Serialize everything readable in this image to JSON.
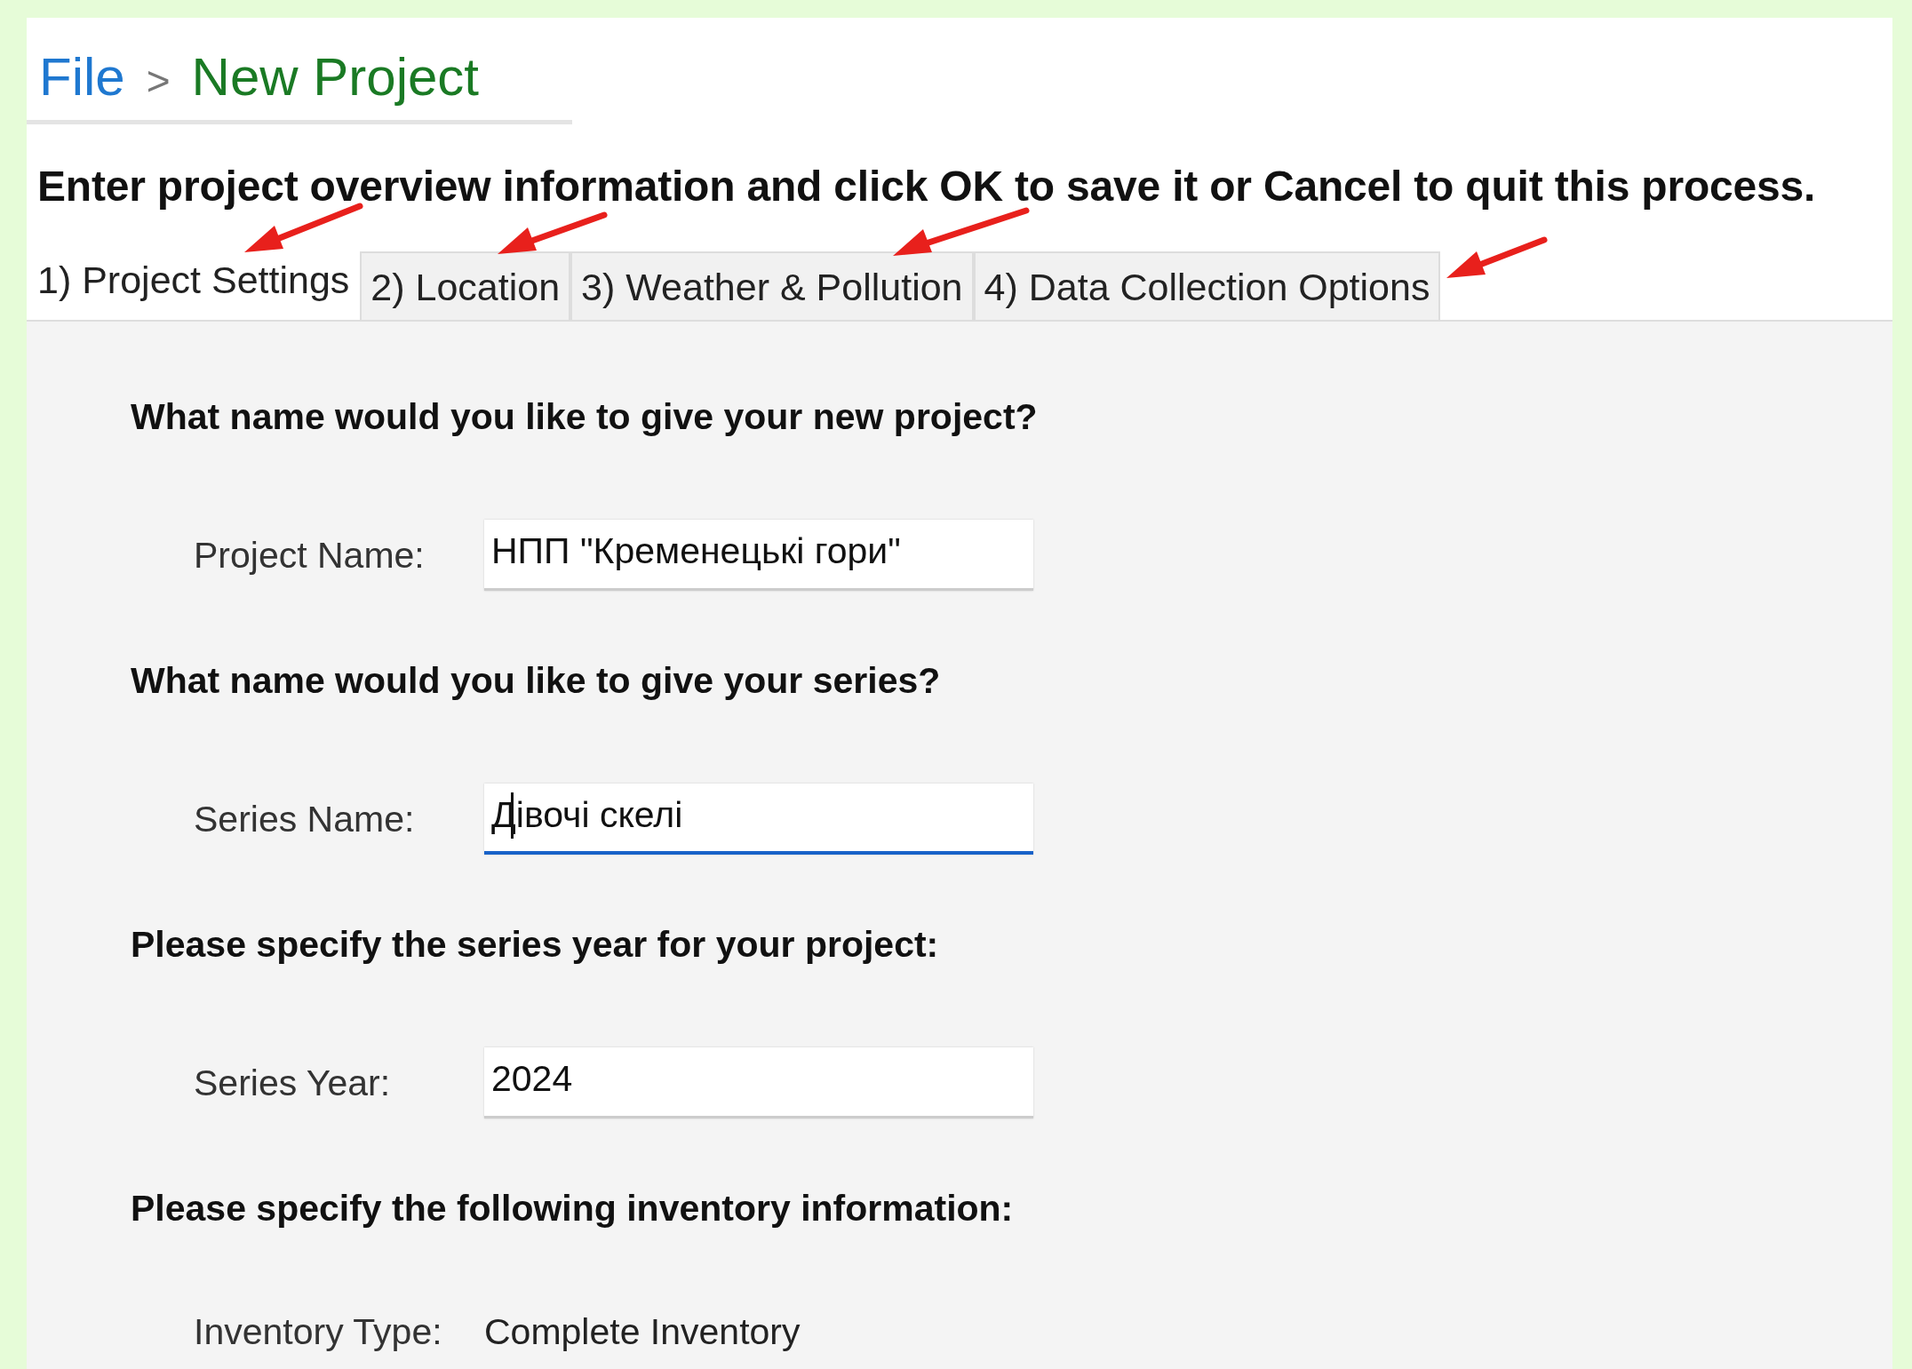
{
  "breadcrumb": {
    "root": "File",
    "separator": ">",
    "current": "New Project"
  },
  "instruction": "Enter project overview information and click OK to save it or Cancel to quit this process.",
  "tabs": [
    {
      "label": "1) Project Settings",
      "selected": true
    },
    {
      "label": "2) Location",
      "selected": false
    },
    {
      "label": "3) Weather & Pollution",
      "selected": false
    },
    {
      "label": "4) Data Collection Options",
      "selected": false
    }
  ],
  "sections": [
    {
      "question": "What name would you like to give your new project?",
      "kind": "field",
      "label": "Project Name:",
      "value": "НПП \"Кременецькі гори\""
    },
    {
      "question": "What name would you like to give your series?",
      "kind": "field",
      "label": "Series Name:",
      "value": "Дівочі скелі",
      "focused": true
    },
    {
      "question": "Please specify the series year for your project:",
      "kind": "field",
      "label": "Series Year:",
      "value": "2024"
    },
    {
      "question": "Please specify the following inventory information:",
      "kind": "text",
      "label": "Inventory Type:",
      "value": "Complete Inventory"
    }
  ]
}
